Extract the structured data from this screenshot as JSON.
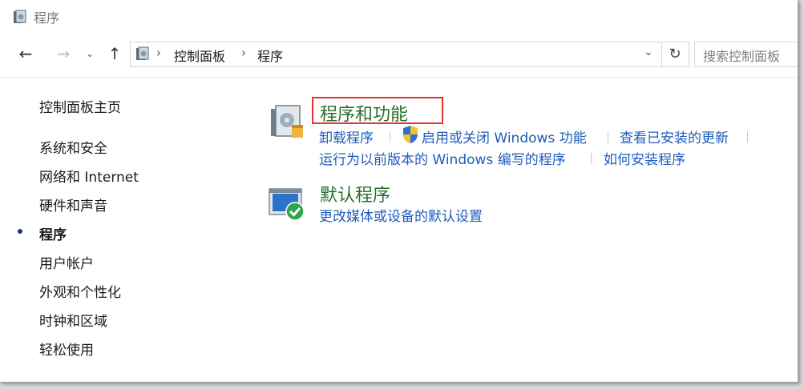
{
  "window": {
    "title": "程序"
  },
  "nav": {
    "back_icon": "arrow-left-icon",
    "forward_icon": "arrow-right-icon",
    "up_icon": "arrow-up-icon"
  },
  "address": {
    "breadcrumbs": [
      "控制面板",
      "程序"
    ]
  },
  "search": {
    "placeholder": "搜索控制面板"
  },
  "sidebar": {
    "home": "控制面板主页",
    "items": [
      {
        "label": "系统和安全"
      },
      {
        "label": "网络和 Internet"
      },
      {
        "label": "硬件和声音"
      },
      {
        "label": "程序",
        "current": true
      },
      {
        "label": "用户帐户"
      },
      {
        "label": "外观和个性化"
      },
      {
        "label": "时钟和区域"
      },
      {
        "label": "轻松使用"
      }
    ]
  },
  "categories": [
    {
      "title": "程序和功能",
      "icon": "programs-features-icon",
      "links": [
        "卸载程序",
        "启用或关闭 Windows 功能",
        "查看已安装的更新",
        "运行为以前版本的 Windows 编写的程序",
        "如何安装程序"
      ]
    },
    {
      "title": "默认程序",
      "icon": "default-programs-icon",
      "links": [
        "更改媒体或设备的默认设置"
      ]
    }
  ],
  "colors": {
    "link": "#1f5cb8",
    "category_title": "#2c6e2c",
    "highlight": "#e53333"
  }
}
